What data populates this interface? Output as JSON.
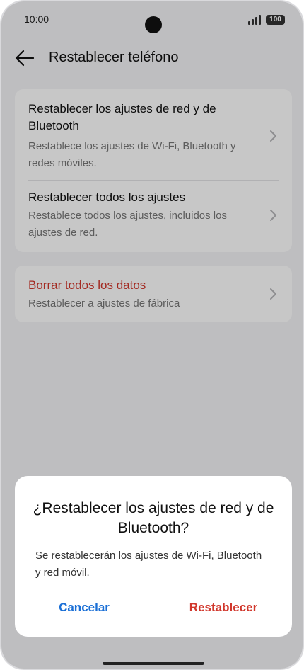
{
  "status_bar": {
    "time": "10:00",
    "battery": "100"
  },
  "app_bar": {
    "title": "Restablecer teléfono"
  },
  "options": [
    {
      "title": "Restablecer los ajustes de red y de Bluetooth",
      "subtitle": "Restablece los ajustes de Wi-Fi, Bluetooth y redes móviles."
    },
    {
      "title": "Restablecer todos los ajustes",
      "subtitle": "Restablece todos los ajustes, incluidos los ajustes de red."
    },
    {
      "title": "Borrar todos los datos",
      "subtitle": "Restablecer a ajustes de fábrica"
    }
  ],
  "dialog": {
    "title": "¿Restablecer los ajustes de red y de Bluetooth?",
    "message": "Se restablecerán los ajustes de Wi-Fi, Bluetooth y red móvil.",
    "cancel_label": "Cancelar",
    "confirm_label": "Restablecer"
  },
  "colors": {
    "danger": "#d1372c",
    "accent": "#1a6fd6"
  },
  "icons": {
    "back": "arrow-left",
    "chevron": "chevron-right"
  }
}
